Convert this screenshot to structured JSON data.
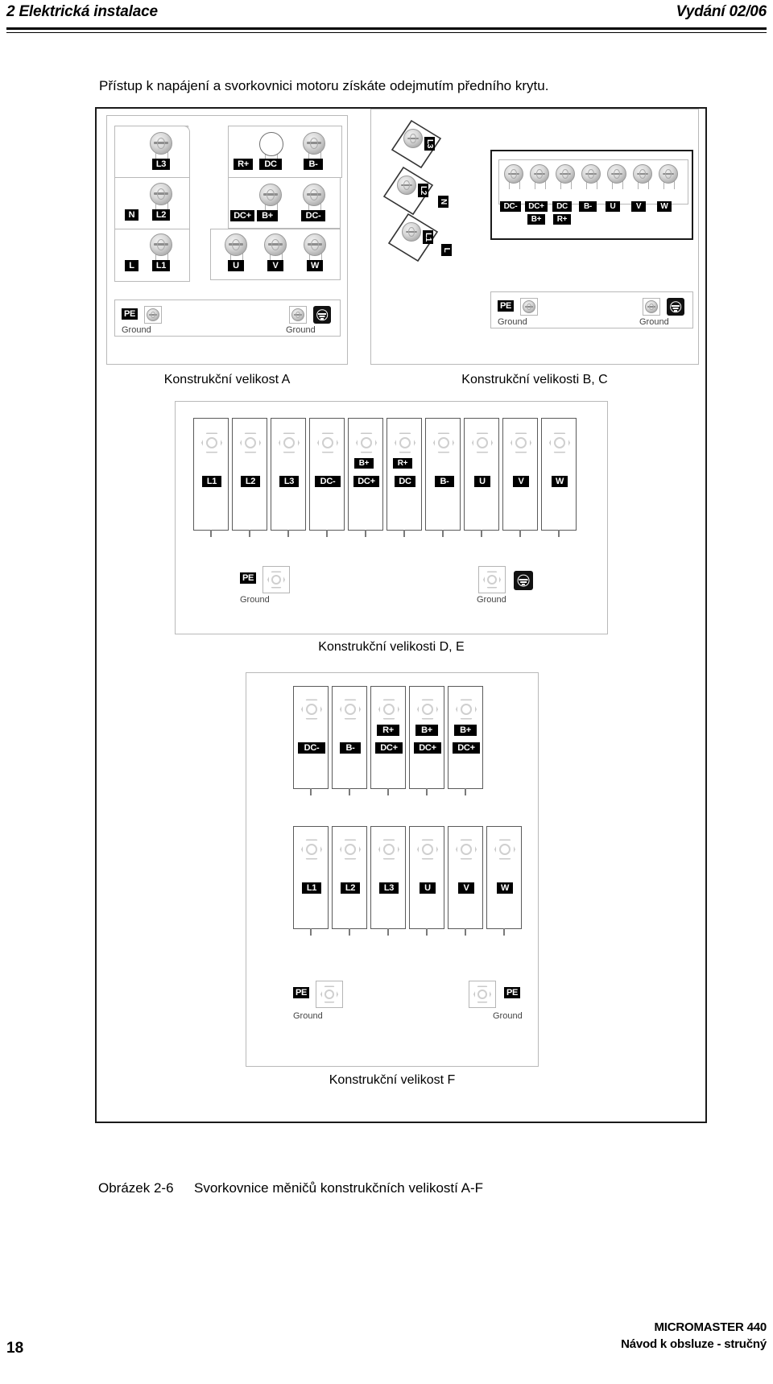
{
  "header": {
    "left": "2 Elektrická instalace",
    "right": "Vydání 02/06"
  },
  "intro": {
    "text": "Přístup k napájení a svorkovnici motoru získáte odejmutím předního krytu."
  },
  "figure": {
    "caption_number": "Obrázek 2-6",
    "caption_text": "Svorkovnice měničů konstrukčních velikostí A-F",
    "panels": [
      {
        "id": "frame-a",
        "caption": "Konstrukční velikost A",
        "mains_terminals": [
          "L3",
          "L2",
          "L1"
        ],
        "mains_alt_labels": [
          "N",
          "L"
        ],
        "dc_row_1": [
          "R+",
          "DC",
          "B-"
        ],
        "dc_row_2": [
          "DC+",
          "B+",
          "DC-"
        ],
        "motor_terminals": [
          "U",
          "V",
          "W"
        ],
        "ground_label": "PE",
        "ground_text_left": "Ground",
        "ground_text_right": "Ground"
      },
      {
        "id": "frame-bc",
        "caption": "Konstrukční velikosti B, C",
        "mains_terminals": [
          "L3",
          "L2",
          "L1"
        ],
        "mains_alt_labels": [
          "N",
          "L"
        ],
        "main_row": [
          "DC-",
          "DC+",
          "DC",
          "B-",
          "U",
          "V",
          "W"
        ],
        "sub_row": [
          "B+",
          "R+"
        ],
        "ground_label": "PE",
        "ground_text_left": "Ground",
        "ground_text_right": "Ground"
      },
      {
        "id": "frame-de",
        "caption": "Konstrukční velikosti D, E",
        "main_row": [
          "L1",
          "L2",
          "L3",
          "DC-",
          "DC+",
          "DC",
          "B-",
          "U",
          "V",
          "W"
        ],
        "sub_row": [
          "B+",
          "R+"
        ],
        "ground_label": "PE",
        "ground_text_left": "Ground",
        "ground_text_right": "Ground"
      },
      {
        "id": "frame-f",
        "caption": "Konstrukční velikost F",
        "dc_row_bottom": [
          "DC-",
          "B-",
          "DC+",
          "DC+",
          "DC+"
        ],
        "dc_row_top": [
          "R+",
          "B+",
          "B+"
        ],
        "motor_row": [
          "L1",
          "L2",
          "L3",
          "U",
          "V",
          "W"
        ],
        "ground_label_left": "PE",
        "ground_label_right": "PE",
        "ground_text_left": "Ground",
        "ground_text_right": "Ground"
      }
    ]
  },
  "footer": {
    "page_number": "18",
    "product": "MICROMASTER 440",
    "doc_type": "Návod k obsluze - stručný"
  }
}
